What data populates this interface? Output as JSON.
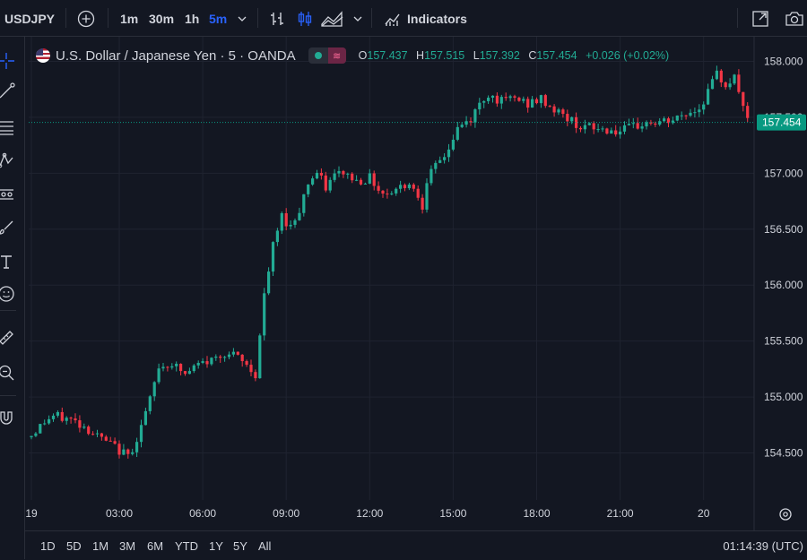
{
  "toolbar": {
    "symbol": "USDJPY",
    "intervals": [
      "1m",
      "30m",
      "1h",
      "5m"
    ],
    "active_interval": "5m",
    "indicators_label": "Indicators",
    "icons": [
      "add-symbol-icon",
      "bar-style-icon",
      "candle-style-icon",
      "area-style-icon",
      "chevron-down-icon",
      "indicators-icon",
      "fullscreen-icon",
      "camera-icon"
    ]
  },
  "legend": {
    "title": "U.S. Dollar / Japanese Yen · 5 · OANDA",
    "o_label": "O",
    "o": "157.437",
    "h_label": "H",
    "h": "157.515",
    "l_label": "L",
    "l": "157.392",
    "c_label": "C",
    "c": "157.454",
    "change": "+0.026 (+0.02%)"
  },
  "left_tools": [
    "crosshair-icon",
    "trend-line-icon",
    "fib-icon",
    "pattern-icon",
    "forecast-icon",
    "brush-icon",
    "text-icon",
    "emoji-icon",
    "ruler-icon",
    "zoom-icon",
    "magnet-icon"
  ],
  "bottom": {
    "ranges": [
      "1D",
      "5D",
      "1M",
      "3M",
      "6M",
      "YTD",
      "1Y",
      "5Y",
      "All"
    ],
    "clock": "01:14:39 (UTC)"
  },
  "colors": {
    "background": "#131722",
    "grid": "#1f2330",
    "up": "#22ab94",
    "down": "#f23645",
    "last_price": "#089981",
    "accent": "#2962ff"
  },
  "chart_data": {
    "type": "candlestick",
    "symbol": "USDJPY",
    "interval": "5",
    "y_ticks": [
      "158.000",
      "157.500",
      "157.000",
      "156.500",
      "156.000",
      "155.500",
      "155.000",
      "154.500"
    ],
    "ylim": [
      154.08,
      158.22
    ],
    "x_ticks": [
      "19",
      "03:00",
      "06:00",
      "09:00",
      "12:00",
      "15:00",
      "18:00",
      "21:00",
      "20"
    ],
    "last_price": "157.454",
    "path": [
      [
        0,
        154.66
      ],
      [
        3,
        154.78
      ],
      [
        5,
        154.83
      ],
      [
        9,
        154.8
      ],
      [
        12,
        154.74
      ],
      [
        15,
        154.65
      ],
      [
        19,
        154.55
      ],
      [
        22,
        154.47
      ],
      [
        24,
        154.63
      ],
      [
        27,
        154.97
      ],
      [
        29,
        155.27
      ],
      [
        32,
        155.3
      ],
      [
        35,
        155.2
      ],
      [
        38,
        155.29
      ],
      [
        41,
        155.33
      ],
      [
        44,
        155.4
      ],
      [
        47,
        155.35
      ],
      [
        49,
        155.28
      ],
      [
        51,
        155.2
      ],
      [
        53,
        155.9
      ],
      [
        55,
        156.35
      ],
      [
        57,
        156.62
      ],
      [
        59,
        156.52
      ],
      [
        61,
        156.68
      ],
      [
        63,
        156.92
      ],
      [
        65,
        157.0
      ],
      [
        67,
        156.87
      ],
      [
        69,
        156.98
      ],
      [
        71,
        157.01
      ],
      [
        74,
        156.93
      ],
      [
        77,
        156.96
      ],
      [
        80,
        156.82
      ],
      [
        83,
        156.86
      ],
      [
        86,
        156.92
      ],
      [
        88,
        156.8
      ],
      [
        89,
        156.72
      ],
      [
        90,
        156.95
      ],
      [
        92,
        157.05
      ],
      [
        95,
        157.22
      ],
      [
        97,
        157.4
      ],
      [
        100,
        157.48
      ],
      [
        102,
        157.62
      ],
      [
        104,
        157.71
      ],
      [
        107,
        157.64
      ],
      [
        110,
        157.67
      ],
      [
        113,
        157.62
      ],
      [
        116,
        157.66
      ],
      [
        119,
        157.57
      ],
      [
        122,
        157.49
      ],
      [
        125,
        157.42
      ],
      [
        128,
        157.4
      ],
      [
        131,
        157.39
      ],
      [
        134,
        157.37
      ],
      [
        137,
        157.41
      ],
      [
        140,
        157.45
      ],
      [
        143,
        157.45
      ],
      [
        146,
        157.47
      ],
      [
        149,
        157.53
      ],
      [
        152,
        157.58
      ],
      [
        154,
        157.73
      ],
      [
        156,
        157.88
      ],
      [
        158,
        157.8
      ],
      [
        160,
        157.85
      ],
      [
        162,
        157.62
      ],
      [
        163,
        157.45
      ]
    ]
  }
}
